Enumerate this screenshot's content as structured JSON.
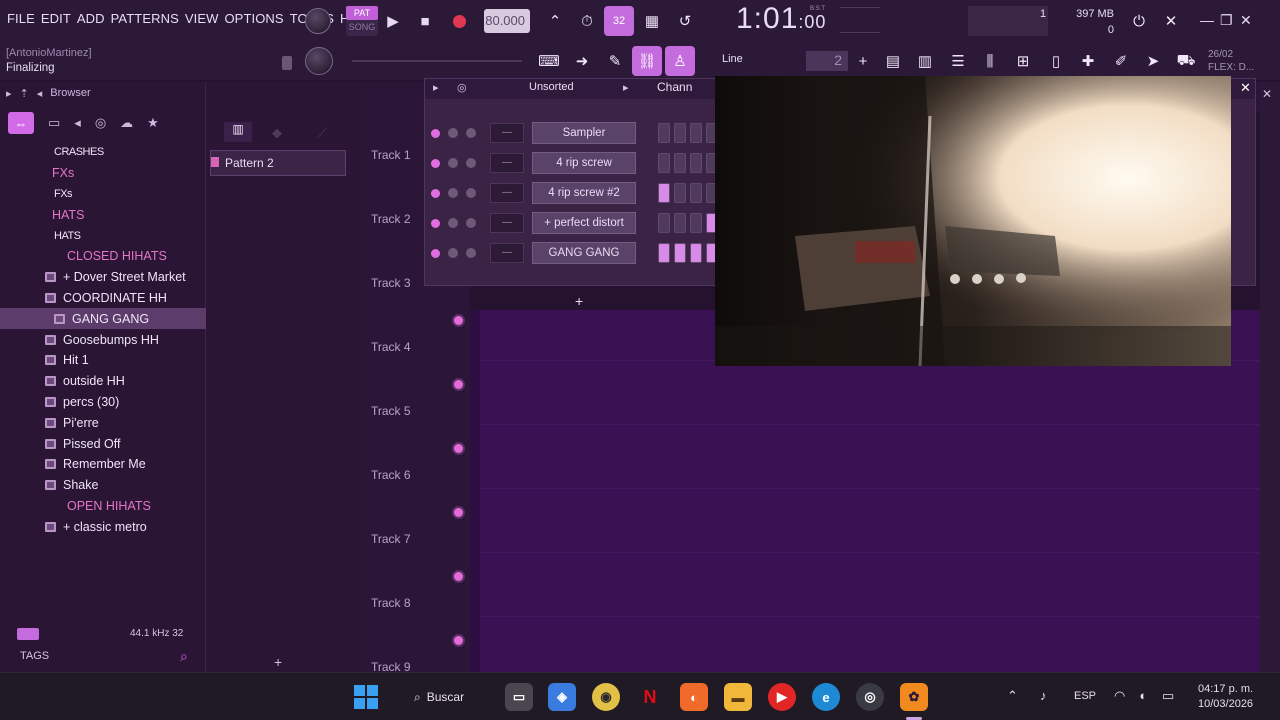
{
  "menu": [
    "FILE",
    "EDIT",
    "ADD",
    "PATTERNS",
    "VIEW",
    "OPTIONS",
    "TOOLS",
    "HELP"
  ],
  "hint": {
    "user": "[AntonioMartinez]",
    "status": "Finalizing"
  },
  "transport": {
    "pat": "PAT",
    "song": "SONG",
    "tempo": "80.000",
    "time_main": "1:01",
    "time_sub": ":00",
    "time_label": "B:S:T",
    "pattern_length_label": "32"
  },
  "monitor": {
    "cpu": "1",
    "memory": "397 MB",
    "voices": "0"
  },
  "toolbar2": {
    "snap_mode": "Line",
    "pattern_num": "2",
    "date": "26/02",
    "flex": "FLEX: D..."
  },
  "browser": {
    "title": "Browser",
    "rows": [
      {
        "label": "CRASHES",
        "kind": "sub",
        "indent": 54
      },
      {
        "label": "FXs",
        "kind": "cat",
        "indent": 52
      },
      {
        "label": "FXs",
        "kind": "sub",
        "indent": 54
      },
      {
        "label": "HATS",
        "kind": "cat",
        "indent": 52
      },
      {
        "label": "HATS",
        "kind": "sub",
        "indent": 54
      },
      {
        "label": "CLOSED HIHATS",
        "kind": "cat",
        "indent": 67
      },
      {
        "label": "+ Dover Street Market",
        "kind": "folder",
        "indent": 63
      },
      {
        "label": "COORDINATE HH",
        "kind": "folder",
        "indent": 63
      },
      {
        "label": "GANG GANG",
        "kind": "folder-sel",
        "indent": 72
      },
      {
        "label": "Goosebumps HH",
        "kind": "folder",
        "indent": 63
      },
      {
        "label": "Hit 1",
        "kind": "folder",
        "indent": 63
      },
      {
        "label": "outside HH",
        "kind": "folder",
        "indent": 63
      },
      {
        "label": "percs (30)",
        "kind": "folder",
        "indent": 63
      },
      {
        "label": "Pi'erre",
        "kind": "folder",
        "indent": 63
      },
      {
        "label": "Pissed Off",
        "kind": "folder",
        "indent": 63
      },
      {
        "label": "Remember Me",
        "kind": "folder",
        "indent": 63
      },
      {
        "label": "Shake",
        "kind": "folder",
        "indent": 63
      },
      {
        "label": "OPEN HIHATS",
        "kind": "cat",
        "indent": 67
      },
      {
        "label": "+ classic metro",
        "kind": "folder",
        "indent": 63
      }
    ],
    "sample_rate": "44.1 kHz 32",
    "tags": "TAGS"
  },
  "picker": {
    "pattern": "Pattern 2"
  },
  "playlist": {
    "tracks": [
      "Track 1",
      "Track 2",
      "Track 3",
      "Track 4",
      "Track 5",
      "Track 6",
      "Track 7",
      "Track 8",
      "Track 9"
    ]
  },
  "rack": {
    "filter": "Unsorted",
    "title": "Chann",
    "channels": [
      {
        "name": "Sampler",
        "steps": [
          0,
          0,
          0,
          0
        ]
      },
      {
        "name": "4 rip screw",
        "steps": [
          0,
          0,
          0,
          0
        ]
      },
      {
        "name": "4 rip screw #2",
        "steps": [
          1,
          0,
          0,
          0
        ]
      },
      {
        "name": "+ perfect distort",
        "steps": [
          0,
          0,
          0,
          1
        ]
      },
      {
        "name": "GANG GANG",
        "steps": [
          1,
          1,
          1,
          1
        ]
      }
    ]
  },
  "taskbar": {
    "search": "Buscar",
    "lang": "ESP",
    "time": "04:17 p. m.",
    "date": "10/03/2026"
  }
}
